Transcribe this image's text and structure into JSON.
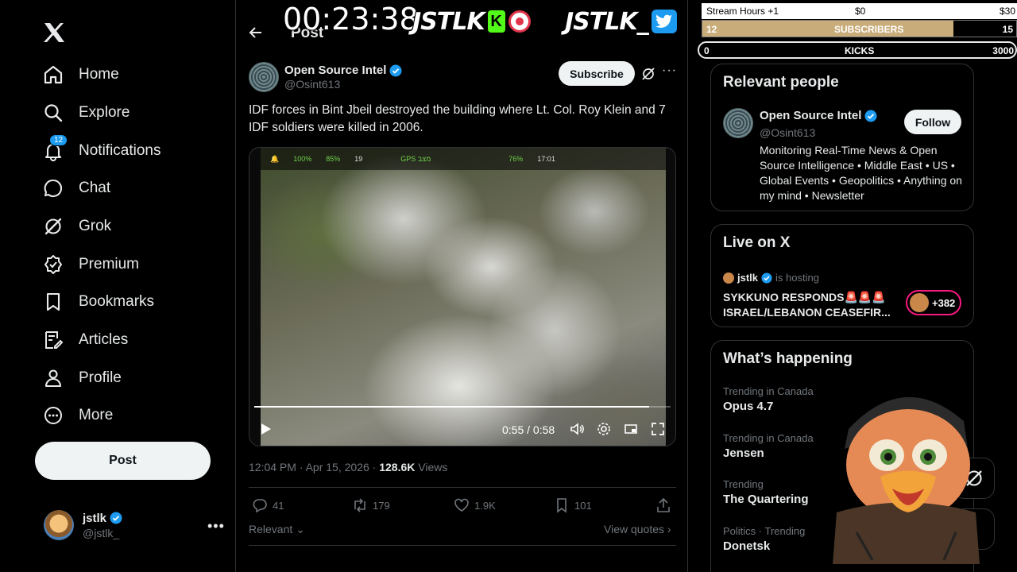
{
  "nav": {
    "items": [
      {
        "label": "Home",
        "icon": "home-icon"
      },
      {
        "label": "Explore",
        "icon": "search-icon"
      },
      {
        "label": "Notifications",
        "icon": "bell-icon",
        "badge": "12"
      },
      {
        "label": "Chat",
        "icon": "chat-icon"
      },
      {
        "label": "Grok",
        "icon": "grok-icon"
      },
      {
        "label": "Premium",
        "icon": "premium-icon"
      },
      {
        "label": "Bookmarks",
        "icon": "bookmark-icon"
      },
      {
        "label": "Articles",
        "icon": "articles-icon"
      },
      {
        "label": "Profile",
        "icon": "profile-icon"
      },
      {
        "label": "More",
        "icon": "more-circle-icon"
      }
    ],
    "post_button": "Post",
    "account": {
      "name": "jstlk",
      "handle": "@jstlk_"
    }
  },
  "main": {
    "heading": "Post",
    "author": {
      "name": "Open Source Intel",
      "handle": "@Osint613"
    },
    "subscribe_label": "Subscribe",
    "text": "IDF forces in Bint Jbeil destroyed the building where Lt. Col. Roy Klein and 7 IDF soldiers were killed in 2006.",
    "video": {
      "time": "0:55 / 0:58",
      "progress": 0.948,
      "hud": {
        "battery1": "100%",
        "battery2": "85%",
        "sats": "19",
        "gps": "GPS מצב",
        "signal": "76%",
        "clock": "17:01"
      }
    },
    "meta": {
      "time": "12:04 PM · Apr 15, 2026 · ",
      "views": "128.6K",
      "views_label": " Views"
    },
    "actions": {
      "replies": "41",
      "reposts": "179",
      "likes": "1.9K",
      "bookmarks": "101"
    },
    "relevant_label": "Relevant",
    "view_quotes_label": "View quotes"
  },
  "sidebar": {
    "relevant": {
      "title": "Relevant people",
      "name": "Open Source Intel",
      "handle": "@Osint613",
      "follow_label": "Follow",
      "bio": "Monitoring Real-Time News & Open Source Intelligence • Middle East • US • Global Events • Geopolitics • Anything on my mind • Newsletter"
    },
    "live": {
      "title": "Live on X",
      "host": "jstlk",
      "host_suffix": "is hosting",
      "space_title": "SYKKUNO RESPONDS🚨🚨🚨 ISRAEL/LEBANON CEASEFIR...",
      "listeners": "+382"
    },
    "happening": {
      "title": "What’s happening",
      "trends": [
        {
          "context": "Trending in Canada",
          "name": "Opus 4.7"
        },
        {
          "context": "Trending in Canada",
          "name": "Jensen"
        },
        {
          "context": "Trending",
          "name": "The Quartering"
        },
        {
          "context": "Politics · Trending",
          "name": "Donetsk"
        }
      ]
    }
  },
  "overlay": {
    "timer": "00:23:38",
    "brand1": "JSTLK",
    "brand2": "JSTLK_",
    "kick_letter": "K",
    "goals": {
      "stream_hours": "Stream Hours +1",
      "money_start": "$0",
      "money_end": "$30",
      "subs_current": "12",
      "subs_label": "SUBSCRIBERS",
      "subs_goal": "15",
      "subs_progress": 0.8,
      "kicks_current": "0",
      "kicks_label": "KICKS",
      "kicks_goal": "3000"
    }
  },
  "colors": {
    "accent": "#1d9bf0",
    "kick_green": "#53fc18",
    "live_pink": "#f91880",
    "goal_fill": "#c8ac7a"
  }
}
